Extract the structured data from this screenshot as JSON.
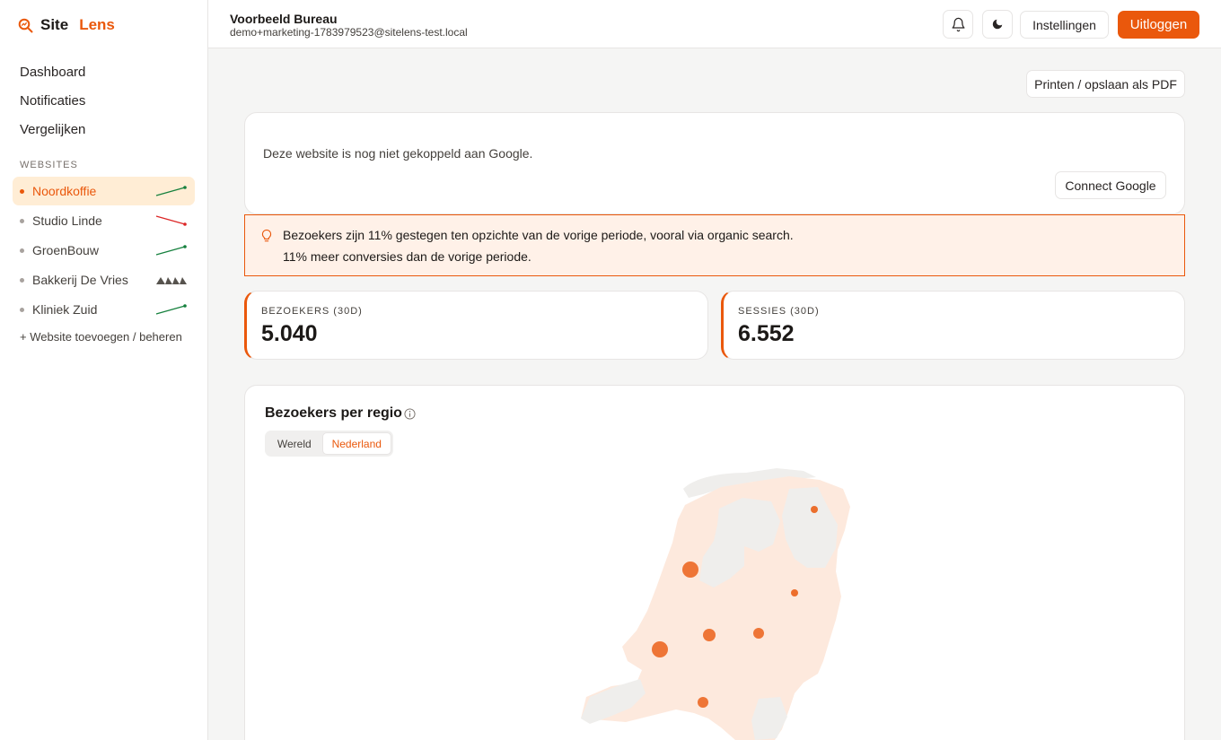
{
  "brand": {
    "word1": "Site",
    "word2": "Lens"
  },
  "nav": [
    {
      "label": "Dashboard"
    },
    {
      "label": "Notificaties"
    },
    {
      "label": "Vergelijken"
    }
  ],
  "sites_heading": "WEBSITES",
  "sites": [
    {
      "name": "Noordkoffie",
      "trend": "up",
      "trend_color": "#15803d",
      "active": true
    },
    {
      "name": "Studio Linde",
      "trend": "down",
      "trend_color": "#dc2626"
    },
    {
      "name": "GroenBouw",
      "trend": "up",
      "trend_color": "#15803d"
    },
    {
      "name": "Bakkerij De Vries",
      "trend": "flat",
      "trend_color": "#57534e"
    },
    {
      "name": "Kliniek Zuid",
      "trend": "up",
      "trend_color": "#15803d"
    }
  ],
  "add_site": "+ Website toevoegen / beheren",
  "header": {
    "org": "Voorbeeld Bureau",
    "email": "demo+marketing-1783979523@sitelens-test.local",
    "settings": "Instellingen",
    "logout": "Uitloggen"
  },
  "print_label": "Printen / opslaan als PDF",
  "google": {
    "message": "Deze website is nog niet gekoppeld aan Google.",
    "button": "Connect Google"
  },
  "insights": [
    "Bezoekers zijn 11% gestegen ten opzichte van de vorige periode, vooral via organic search.",
    "11% meer conversies dan de vorige periode."
  ],
  "stats": [
    {
      "label": "BEZOEKERS (30D)",
      "value": "5.040"
    },
    {
      "label": "SESSIES (30D)",
      "value": "6.552"
    }
  ],
  "map": {
    "title": "Bezoekers per regio",
    "tabs": [
      {
        "label": "Wereld"
      },
      {
        "label": "Nederland",
        "active": true
      }
    ],
    "accent": "#ea580c"
  }
}
